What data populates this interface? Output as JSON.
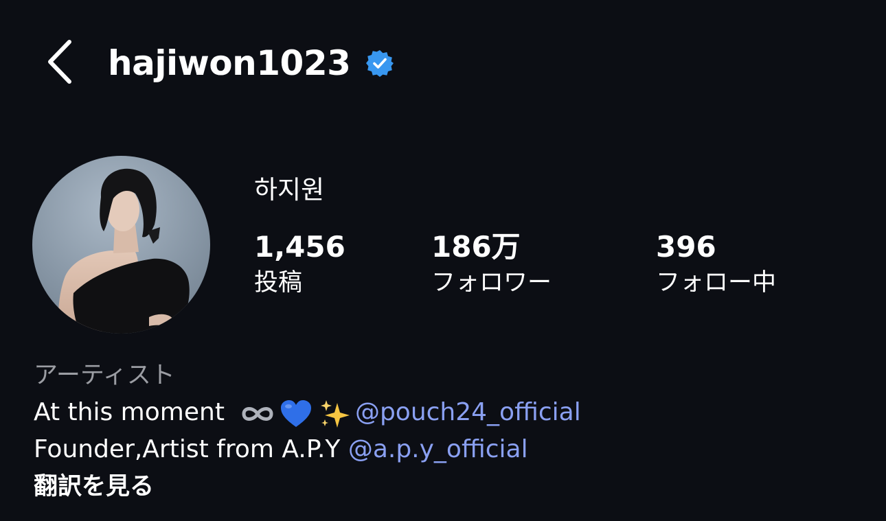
{
  "header": {
    "username": "hajiwon1023",
    "verified": true,
    "back_icon": "chevron-left-icon"
  },
  "profile": {
    "display_name": "하지원",
    "stats": {
      "posts": {
        "value": "1,456",
        "label": "投稿"
      },
      "followers": {
        "value": "186万",
        "label": "フォロワー"
      },
      "following": {
        "value": "396",
        "label": "フォロー中"
      }
    },
    "category": "アーティスト",
    "bio": {
      "line1_text": "At this moment",
      "line1_emojis": [
        "infinity-icon",
        "blue-heart-icon",
        "sparkles-icon"
      ],
      "line1_mention": "@pouch24_official",
      "line2_text": "Founder,Artist from A.P.Y ",
      "line2_mention": "@a.p.y_official"
    },
    "translate_label": "翻訳を見る"
  },
  "colors": {
    "background": "#0c0e14",
    "mention": "#8aa0f2",
    "verified_badge": "#3897f0",
    "category_text": "#9b9da3"
  }
}
